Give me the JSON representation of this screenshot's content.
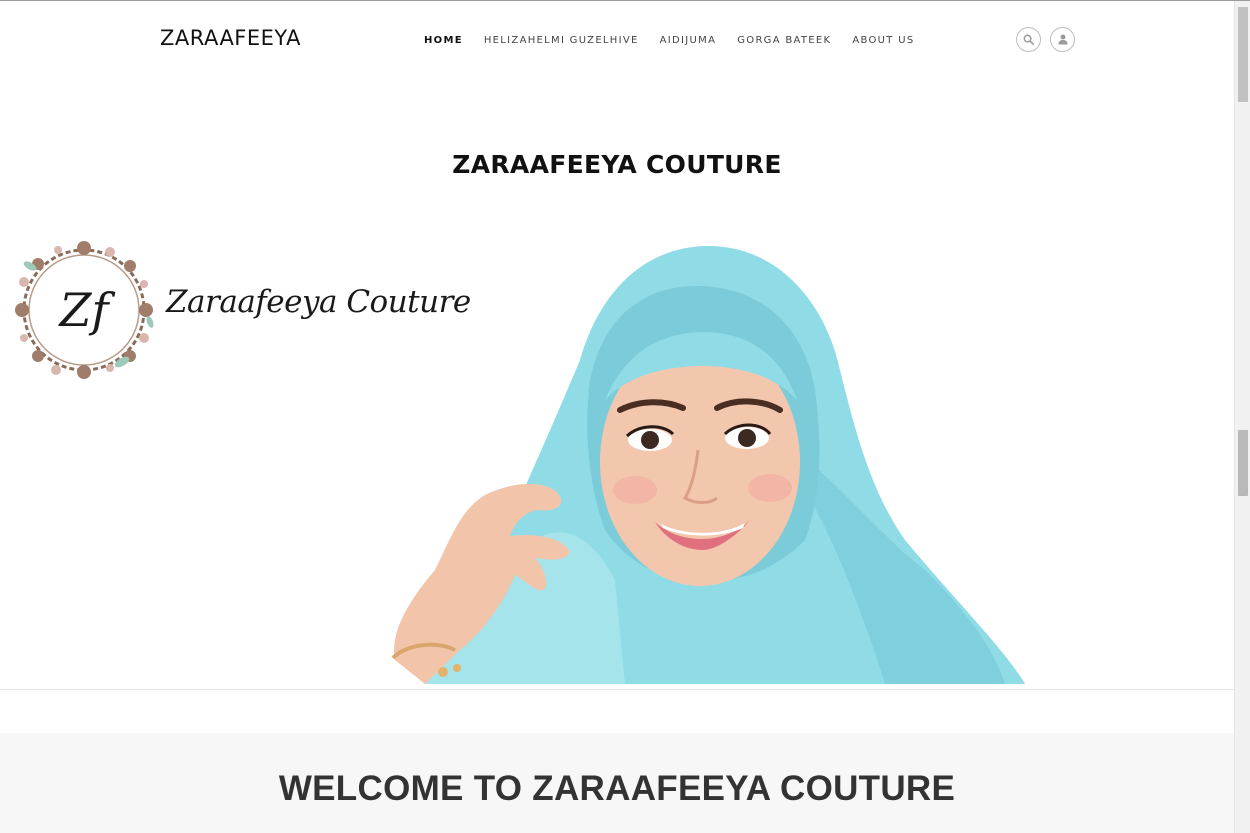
{
  "header": {
    "logo": "ZARAAFEEYA",
    "nav": [
      {
        "label": "HOME",
        "active": true
      },
      {
        "label": "HELIZAHELMI GUZELHIVE",
        "active": false
      },
      {
        "label": "AIDIJUMA",
        "active": false
      },
      {
        "label": "GORGA BATEEK",
        "active": false
      },
      {
        "label": "ABOUT US",
        "active": false
      }
    ],
    "icons": [
      "search-icon",
      "user-icon"
    ]
  },
  "hero": {
    "title": "ZARAAFEEYA COUTURE",
    "banner": {
      "monogram": "Zf",
      "brand_script": "Zaraafeeya Couture"
    }
  },
  "welcome": {
    "title": "WELCOME TO ZARAAFEEYA COUTURE"
  },
  "colors": {
    "scarf": "#8fdbe6",
    "welcome_bg": "#f7f7f7",
    "text_dark": "#111111"
  }
}
